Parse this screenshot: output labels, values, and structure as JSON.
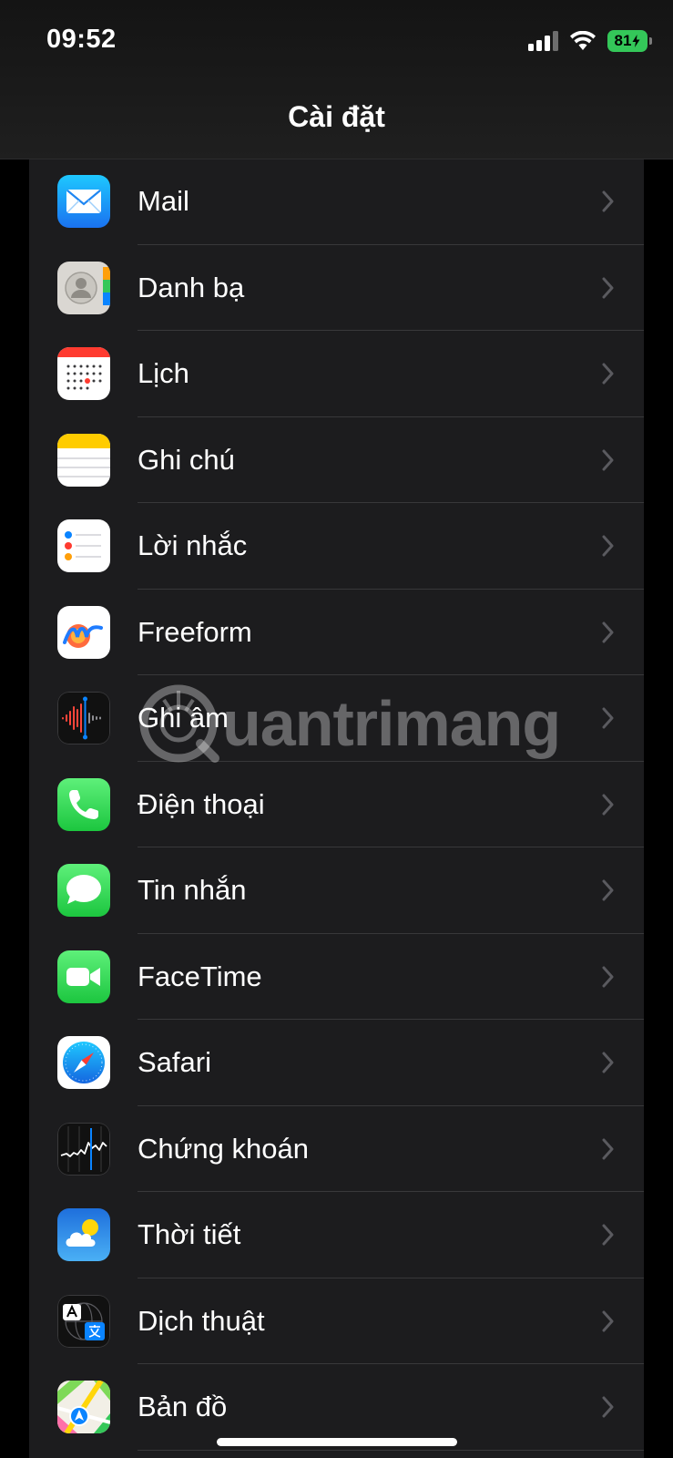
{
  "status_bar": {
    "time": "09:52",
    "battery_level": "81",
    "signal_icon": "signal-bars-icon",
    "wifi_icon": "wifi-icon",
    "battery_icon": "battery-charging-icon"
  },
  "nav": {
    "title": "Cài đặt"
  },
  "settings_items": [
    {
      "label": "Mail",
      "icon": "mail-icon"
    },
    {
      "label": "Danh bạ",
      "icon": "contacts-icon"
    },
    {
      "label": "Lịch",
      "icon": "calendar-icon"
    },
    {
      "label": "Ghi chú",
      "icon": "notes-icon"
    },
    {
      "label": "Lời nhắc",
      "icon": "reminders-icon"
    },
    {
      "label": "Freeform",
      "icon": "freeform-icon"
    },
    {
      "label": "Ghi âm",
      "icon": "voice-memos-icon"
    },
    {
      "label": "Điện thoại",
      "icon": "phone-icon"
    },
    {
      "label": "Tin nhắn",
      "icon": "messages-icon"
    },
    {
      "label": "FaceTime",
      "icon": "facetime-icon"
    },
    {
      "label": "Safari",
      "icon": "safari-icon"
    },
    {
      "label": "Chứng khoán",
      "icon": "stocks-icon"
    },
    {
      "label": "Thời tiết",
      "icon": "weather-icon"
    },
    {
      "label": "Dịch thuật",
      "icon": "translate-icon"
    },
    {
      "label": "Bản đồ",
      "icon": "maps-icon"
    }
  ],
  "watermark": {
    "text": "uantrimang"
  },
  "colors": {
    "background": "#000000",
    "group_background": "#1c1c1e",
    "separator": "#38383a",
    "chevron": "#5a5a5f",
    "battery_green": "#34c759"
  }
}
